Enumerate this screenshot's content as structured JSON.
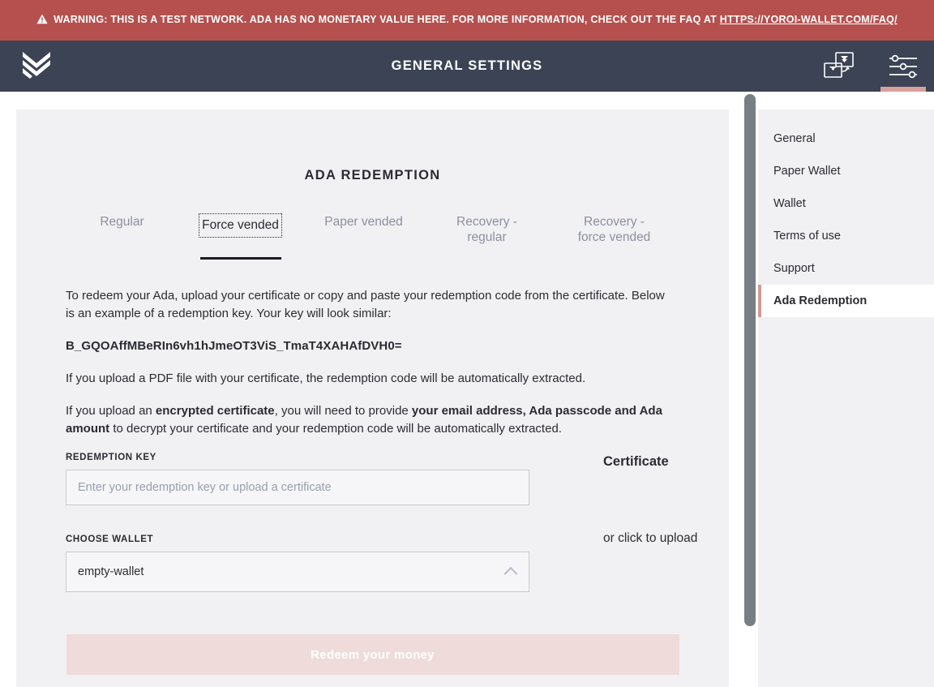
{
  "warning": {
    "icon": "warning-triangle-icon",
    "text_before": "WARNING: THIS IS A TEST NETWORK. ADA HAS NO MONETARY VALUE HERE. FOR MORE INFORMATION, CHECK OUT THE FAQ AT ",
    "link_text": "HTTPS://YOROI-WALLET.COM/FAQ/",
    "background": "#b5504e"
  },
  "topbar": {
    "logo": "yoroi-logo-icon",
    "title": "GENERAL SETTINGS",
    "background": "#3b4355",
    "icons": [
      {
        "name": "wallet-transfer-icon",
        "active": false
      },
      {
        "name": "settings-sliders-icon",
        "active": true,
        "accent": "#d8a09b"
      }
    ]
  },
  "main": {
    "page_title": "ADA REDEMPTION",
    "tabs": [
      {
        "label": "Regular",
        "active": false
      },
      {
        "label": "Force vended",
        "active": true
      },
      {
        "label": "Paper vended",
        "active": false
      },
      {
        "label_line1": "Recovery -",
        "label_line2": "regular",
        "active": false
      },
      {
        "label_line1": "Recovery -",
        "label_line2": "force vended",
        "active": false
      }
    ],
    "paragraphs": {
      "intro": "To redeem your Ada, upload your certificate or copy and paste your redemption code from the certificate. Below is an example of a redemption key. Your key will look similar:",
      "key_sample": "B_GQOAffMBeRIn6vh1hJmeOT3ViS_TmaT4XAHAfDVH0=",
      "pdf_note": "If you upload a PDF file with your certificate, the redemption code will be automatically extracted.",
      "encrypted_p1": "If you upload an ",
      "encrypted_b1": "encrypted certificate",
      "encrypted_p2": ", you will need to provide ",
      "encrypted_b2": "your email address, Ada passcode and Ada amount",
      "encrypted_p3": " to decrypt your certificate and your redemption code will be automatically extracted."
    },
    "form": {
      "redemption_key_label": "REDEMPTION KEY",
      "redemption_key_value": "",
      "redemption_key_placeholder": "Enter your redemption key or upload a certificate",
      "choose_wallet_label": "CHOOSE WALLET",
      "choose_wallet_value": "empty-wallet",
      "choose_wallet_chevron": "chevron-up-icon"
    },
    "certificate": {
      "title": "Certificate",
      "upload_hint": "or click to upload"
    },
    "submit_label": "Redeem your money"
  },
  "settings_menu": {
    "items": [
      {
        "label": "General",
        "active": false
      },
      {
        "label": "Paper Wallet",
        "active": false
      },
      {
        "label": "Wallet",
        "active": false
      },
      {
        "label": "Terms of use",
        "active": false
      },
      {
        "label": "Support",
        "active": false
      },
      {
        "label": "Ada Redemption",
        "active": true
      }
    ],
    "active_accent": "#cf9a93"
  }
}
